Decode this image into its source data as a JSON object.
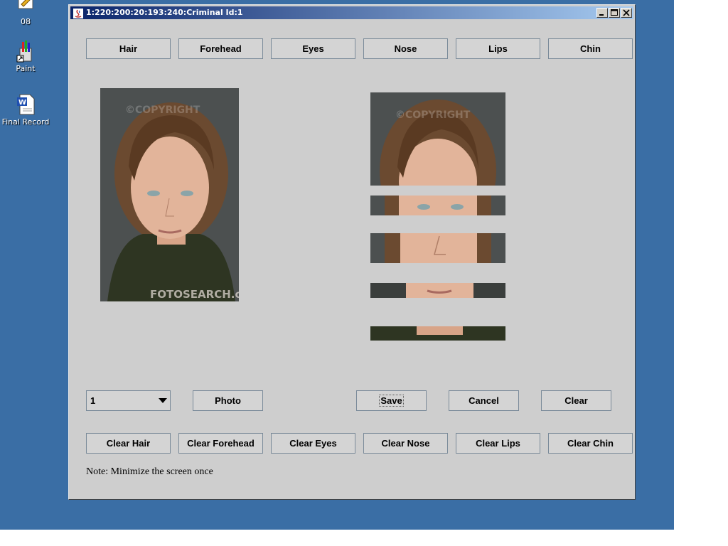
{
  "desktop": {
    "icons": [
      {
        "label": "08",
        "icon": "shortcut-icon"
      },
      {
        "label": "Paint",
        "icon": "paint-icon"
      },
      {
        "label": "Final Record",
        "icon": "word-document-icon"
      }
    ]
  },
  "window": {
    "title": "1:220:200:20:193:240:Criminal Id:1",
    "controls": {
      "minimize": "minimize",
      "maximize": "maximize",
      "close": "close"
    }
  },
  "feature_buttons": [
    "Hair",
    "Forehead",
    "Eyes",
    "Nose",
    "Lips",
    "Chin"
  ],
  "face_strips": [
    "Hair",
    "Eyes",
    "Nose",
    "Lips",
    "Chin"
  ],
  "watermark": {
    "copyright": "©COPYRIGHT",
    "brand": "FOTOSEARCH.com"
  },
  "controls": {
    "id_select": {
      "value": "1"
    },
    "photo_label": "Photo",
    "save_label": "Save",
    "cancel_label": "Cancel",
    "clear_label": "Clear"
  },
  "clear_buttons": [
    "Clear Hair",
    "Clear Forehead",
    "Clear Eyes",
    "Clear Nose",
    "Clear Lips",
    "Clear Chin"
  ],
  "note": "Note: Minimize the screen once",
  "colors": {
    "desktop": "#3a6ea5",
    "window_bg": "#cecece",
    "title_start": "#0a246a",
    "title_end": "#a6caf0"
  }
}
